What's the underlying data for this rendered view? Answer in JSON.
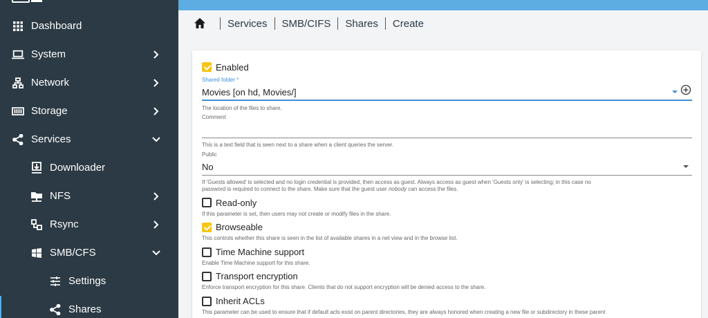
{
  "sidebar": {
    "items": [
      {
        "label": "Dashboard",
        "icon": "grid-icon"
      },
      {
        "label": "System",
        "icon": "laptop-icon"
      },
      {
        "label": "Network",
        "icon": "network-icon"
      },
      {
        "label": "Storage",
        "icon": "storage-icon"
      },
      {
        "label": "Services",
        "icon": "share-icon"
      },
      {
        "label": "Downloader",
        "icon": "download-icon"
      },
      {
        "label": "NFS",
        "icon": "folder-network-icon"
      },
      {
        "label": "Rsync",
        "icon": "sync-icon"
      },
      {
        "label": "SMB/CFS",
        "icon": "windows-icon"
      },
      {
        "label": "Settings",
        "icon": "tune-icon"
      },
      {
        "label": "Shares",
        "icon": "share-icon"
      }
    ]
  },
  "breadcrumb": [
    "Services",
    "SMB/CIFS",
    "Shares",
    "Create"
  ],
  "form": {
    "enabled": {
      "label": "Enabled",
      "checked": true
    },
    "shared_folder": {
      "label": "Shared folder *",
      "value": "Movies [on hd, Movies/]",
      "hint": "The location of the files to share."
    },
    "comment": {
      "label": "Comment",
      "value": "",
      "hint": "This is a text field that is seen next to a share when a client queries the server."
    },
    "public": {
      "label": "Public",
      "value": "No",
      "hint_line1": "If 'Guests allowed' is selected and no login credential is provided, then access as guest. Always access as guest when 'Guests only' is selecting; in this case no",
      "hint_line2_a": "password is required to connect to the share. Make sure that the guest user",
      "hint_line2_em": "nobody",
      "hint_line2_b": "can access the files."
    },
    "readonly": {
      "label": "Read-only",
      "checked": false,
      "hint": "If this parameter is set, then users may not create or modify files in the share."
    },
    "browseable": {
      "label": "Browseable",
      "checked": true,
      "hint": "This controls whether this share is seen in the list of available shares in a net view and in the browse list."
    },
    "timemachine": {
      "label": "Time Machine support",
      "checked": false,
      "hint": "Enable Time Machine support for this share."
    },
    "transport": {
      "label": "Transport encryption",
      "checked": false,
      "hint": "Enforce transport encryption for this share. Clients that do not support encryption will be denied access to the share."
    },
    "inherit": {
      "label": "Inherit ACLs",
      "checked": false,
      "hint": "This parameter can be used to ensure that if default acls exist on parent directories, they are always honored when creating a new file or subdirectory in these parent"
    }
  },
  "colors": {
    "sidebar_bg": "#2b3a44",
    "topbar": "#5dade2",
    "checkbox_checked": "#f5c518",
    "accent": "#3d8fd6"
  }
}
